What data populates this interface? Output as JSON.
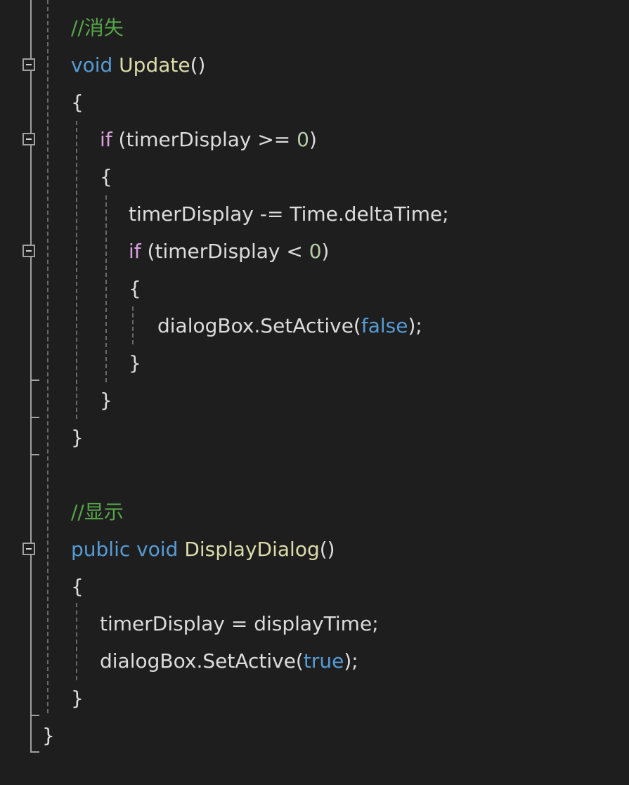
{
  "colors": {
    "background": "#1e1e1e",
    "comment": "#57a64a",
    "keyword": "#569cd6",
    "control": "#d8a0df",
    "method": "#dcdcaa",
    "number": "#b5cea8",
    "text": "#dcdcdc"
  },
  "code_lines": [
    {
      "indent": 1,
      "tokens": [
        {
          "t": "comment",
          "v": "//消失"
        }
      ]
    },
    {
      "indent": 1,
      "fold": true,
      "tokens": [
        {
          "t": "keyword",
          "v": "void"
        },
        {
          "t": "text",
          "v": " "
        },
        {
          "t": "method",
          "v": "Update"
        },
        {
          "t": "text",
          "v": "()"
        }
      ]
    },
    {
      "indent": 1,
      "tokens": [
        {
          "t": "text",
          "v": "{"
        }
      ]
    },
    {
      "indent": 2,
      "fold": true,
      "tokens": [
        {
          "t": "control",
          "v": "if"
        },
        {
          "t": "text",
          "v": " (timerDisplay >= "
        },
        {
          "t": "number",
          "v": "0"
        },
        {
          "t": "text",
          "v": ")"
        }
      ]
    },
    {
      "indent": 2,
      "tokens": [
        {
          "t": "text",
          "v": "{"
        }
      ]
    },
    {
      "indent": 3,
      "tokens": [
        {
          "t": "text",
          "v": "timerDisplay -= Time.deltaTime;"
        }
      ]
    },
    {
      "indent": 3,
      "fold": true,
      "tokens": [
        {
          "t": "control",
          "v": "if"
        },
        {
          "t": "text",
          "v": " (timerDisplay < "
        },
        {
          "t": "number",
          "v": "0"
        },
        {
          "t": "text",
          "v": ")"
        }
      ]
    },
    {
      "indent": 3,
      "tokens": [
        {
          "t": "text",
          "v": "{"
        }
      ]
    },
    {
      "indent": 4,
      "tokens": [
        {
          "t": "text",
          "v": "dialogBox.SetActive("
        },
        {
          "t": "keyword",
          "v": "false"
        },
        {
          "t": "text",
          "v": ");"
        }
      ]
    },
    {
      "indent": 3,
      "tokens": [
        {
          "t": "text",
          "v": "}"
        }
      ]
    },
    {
      "indent": 2,
      "tokens": [
        {
          "t": "text",
          "v": "}"
        }
      ]
    },
    {
      "indent": 1,
      "tokens": [
        {
          "t": "text",
          "v": "}"
        }
      ]
    },
    {
      "indent": 1,
      "tokens": []
    },
    {
      "indent": 1,
      "tokens": [
        {
          "t": "comment",
          "v": "//显示"
        }
      ]
    },
    {
      "indent": 1,
      "fold": true,
      "tokens": [
        {
          "t": "keyword",
          "v": "public"
        },
        {
          "t": "text",
          "v": " "
        },
        {
          "t": "keyword",
          "v": "void"
        },
        {
          "t": "text",
          "v": " "
        },
        {
          "t": "method",
          "v": "DisplayDialog"
        },
        {
          "t": "text",
          "v": "()"
        }
      ]
    },
    {
      "indent": 1,
      "tokens": [
        {
          "t": "text",
          "v": "{"
        }
      ]
    },
    {
      "indent": 2,
      "tokens": [
        {
          "t": "text",
          "v": "timerDisplay = displayTime;"
        }
      ]
    },
    {
      "indent": 2,
      "tokens": [
        {
          "t": "text",
          "v": "dialogBox.SetActive("
        },
        {
          "t": "keyword",
          "v": "true"
        },
        {
          "t": "text",
          "v": ");"
        }
      ]
    },
    {
      "indent": 1,
      "tokens": [
        {
          "t": "text",
          "v": "}"
        }
      ]
    },
    {
      "indent": 0,
      "tokens": [
        {
          "t": "text",
          "v": "}"
        }
      ]
    }
  ]
}
